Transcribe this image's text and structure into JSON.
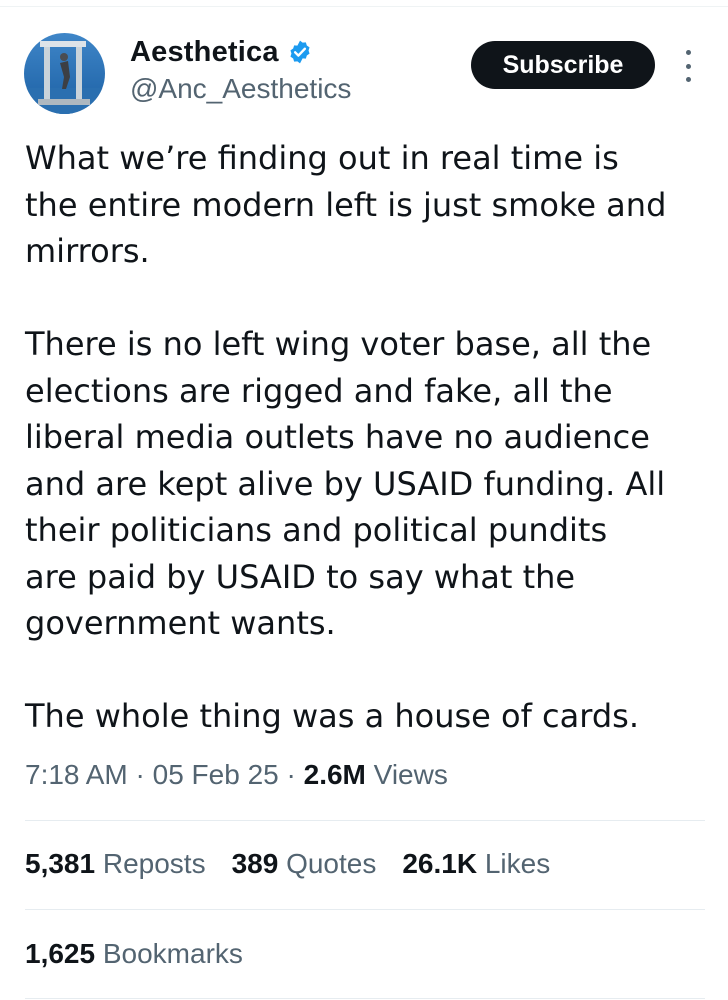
{
  "author": {
    "display_name": "Aesthetica",
    "handle": "@Anc_Aesthetics",
    "verified": true,
    "badge_color": "#1d9bf0"
  },
  "subscribe_label": "Subscribe",
  "icons": {
    "verified": "verified-badge-icon",
    "more": "more-vertical-icon",
    "avatar": "avatar-image"
  },
  "tweet": {
    "paragraphs": [
      [
        "What we’re finding out in real time is",
        "the entire modern left is just smoke and",
        "mirrors."
      ],
      [
        "There is no left wing voter base, all the",
        "elections are rigged and fake, all the",
        "liberal media outlets have no audience",
        "and are kept alive by USAID funding. All",
        "their politicians and political pundits",
        "are paid by USAID to say what the",
        "government wants."
      ],
      [
        "The whole thing was a house of cards."
      ]
    ]
  },
  "meta": {
    "time": "7:18 AM",
    "sep1": " · ",
    "date": "05 Feb 25",
    "sep2": " · ",
    "views_count": "2.6M",
    "views_label": " Views"
  },
  "stats": {
    "reposts": {
      "count": "5,381",
      "label": " Reposts"
    },
    "quotes": {
      "count": "389",
      "label": " Quotes"
    },
    "likes": {
      "count": "26.1K",
      "label": " Likes"
    },
    "bookmarks": {
      "count": "1,625",
      "label": " Bookmarks"
    }
  }
}
